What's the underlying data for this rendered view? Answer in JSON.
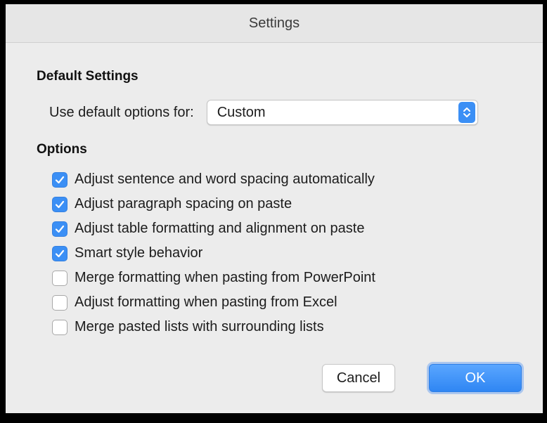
{
  "window": {
    "title": "Settings"
  },
  "default_settings": {
    "heading": "Default Settings",
    "label": "Use default options for:",
    "selected": "Custom"
  },
  "options": {
    "heading": "Options",
    "items": [
      {
        "label": "Adjust sentence and word spacing automatically",
        "checked": true
      },
      {
        "label": "Adjust paragraph spacing on paste",
        "checked": true
      },
      {
        "label": "Adjust table formatting and alignment on paste",
        "checked": true
      },
      {
        "label": "Smart style behavior",
        "checked": true
      },
      {
        "label": "Merge formatting when pasting from PowerPoint",
        "checked": false
      },
      {
        "label": "Adjust formatting when pasting from Excel",
        "checked": false
      },
      {
        "label": "Merge pasted lists with surrounding lists",
        "checked": false
      }
    ]
  },
  "buttons": {
    "cancel": "Cancel",
    "ok": "OK"
  },
  "colors": {
    "accent": "#3b8ff5",
    "window_bg": "#ececec",
    "titlebar_bg": "#e6e6e6"
  }
}
